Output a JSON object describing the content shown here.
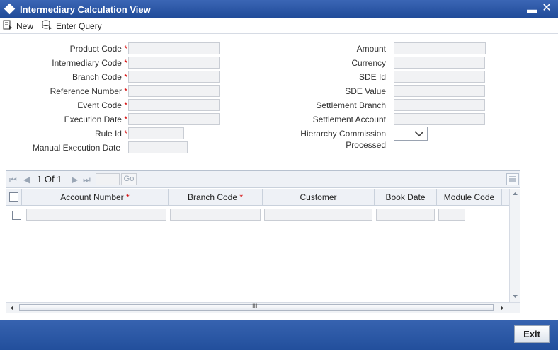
{
  "window": {
    "title": "Intermediary Calculation View"
  },
  "toolbar": {
    "new_label": "New",
    "enter_query_label": "Enter Query"
  },
  "left_fields": [
    {
      "label": "Product Code",
      "required": "*"
    },
    {
      "label": "Intermediary Code",
      "required": "*"
    },
    {
      "label": "Branch Code",
      "required": "*"
    },
    {
      "label": "Reference Number",
      "required": "*"
    },
    {
      "label": "Event Code",
      "required": "*"
    },
    {
      "label": "Execution Date",
      "required": "*"
    },
    {
      "label": "Rule Id",
      "required": "*"
    },
    {
      "label": "Manual Execution Date",
      "required": ""
    }
  ],
  "right_fields": [
    {
      "label": "Amount"
    },
    {
      "label": "Currency"
    },
    {
      "label": "SDE Id"
    },
    {
      "label": "SDE Value"
    },
    {
      "label": "Settlement Branch"
    },
    {
      "label": "Settlement Account"
    }
  ],
  "hierarchy": {
    "label_line1": "Hierarchy Commission",
    "label_line2": "Processed",
    "value": ""
  },
  "grid": {
    "pager": {
      "current": "1",
      "of_label": "Of",
      "total": "1"
    },
    "go_label": "Go",
    "columns": [
      {
        "label": "Account Number",
        "required": "*"
      },
      {
        "label": "Branch Code",
        "required": "*"
      },
      {
        "label": "Customer",
        "required": ""
      },
      {
        "label": "Book Date",
        "required": ""
      },
      {
        "label": "Module Code",
        "required": ""
      }
    ],
    "scroll_grip": "III"
  },
  "footer": {
    "exit_label": "Exit"
  },
  "colors": {
    "title_bar": "#2a56a6",
    "required": "#d40000",
    "field_bg": "#f1f2f4"
  },
  "icons": [
    "diamond-icon",
    "minimize-icon",
    "close-icon",
    "new-icon",
    "enter-query-icon",
    "first-page-icon",
    "prev-page-icon",
    "next-page-icon",
    "last-page-icon",
    "list-view-icon",
    "checkbox",
    "dropdown-arrow-icon"
  ]
}
